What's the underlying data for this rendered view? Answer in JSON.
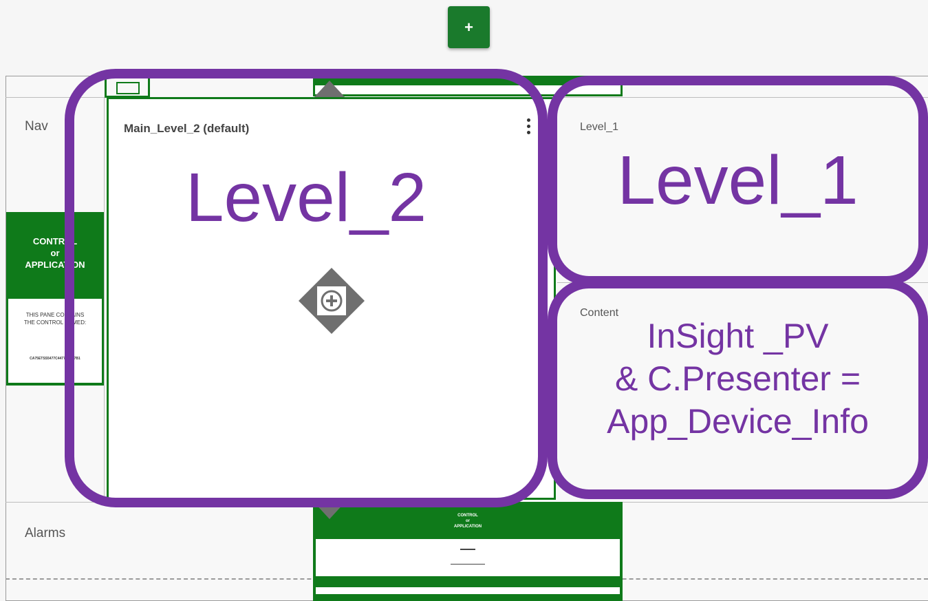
{
  "toolbar": {
    "add_label": "+"
  },
  "rows": {
    "nav": "Nav",
    "alarms": "Alarms",
    "content": "Content"
  },
  "panes": {
    "level2_title": "Main_Level_2 (default)",
    "level1_title": "Level_1"
  },
  "control_card": {
    "title_line1": "CONTROL",
    "title_line2": "or",
    "title_line3": "APPLICATION",
    "body_line1": "THIS PANE CONTAINS",
    "body_line2": "THE CONTROL NAMED:",
    "body_line3": "CA75ETSS5477C4477C6B77B1"
  },
  "mini_card": {
    "title_line1": "CONTROL",
    "title_line2": "or",
    "title_line3": "APPLICATION"
  },
  "annotations": {
    "level2": "Level_2",
    "level1": "Level_1",
    "content_line1": "InSight _PV",
    "content_line2": "& C.Presenter =",
    "content_line3": "App_Device_Info"
  },
  "colors": {
    "accent_green": "#0f7a1a",
    "annotation_purple": "#7434a3"
  }
}
